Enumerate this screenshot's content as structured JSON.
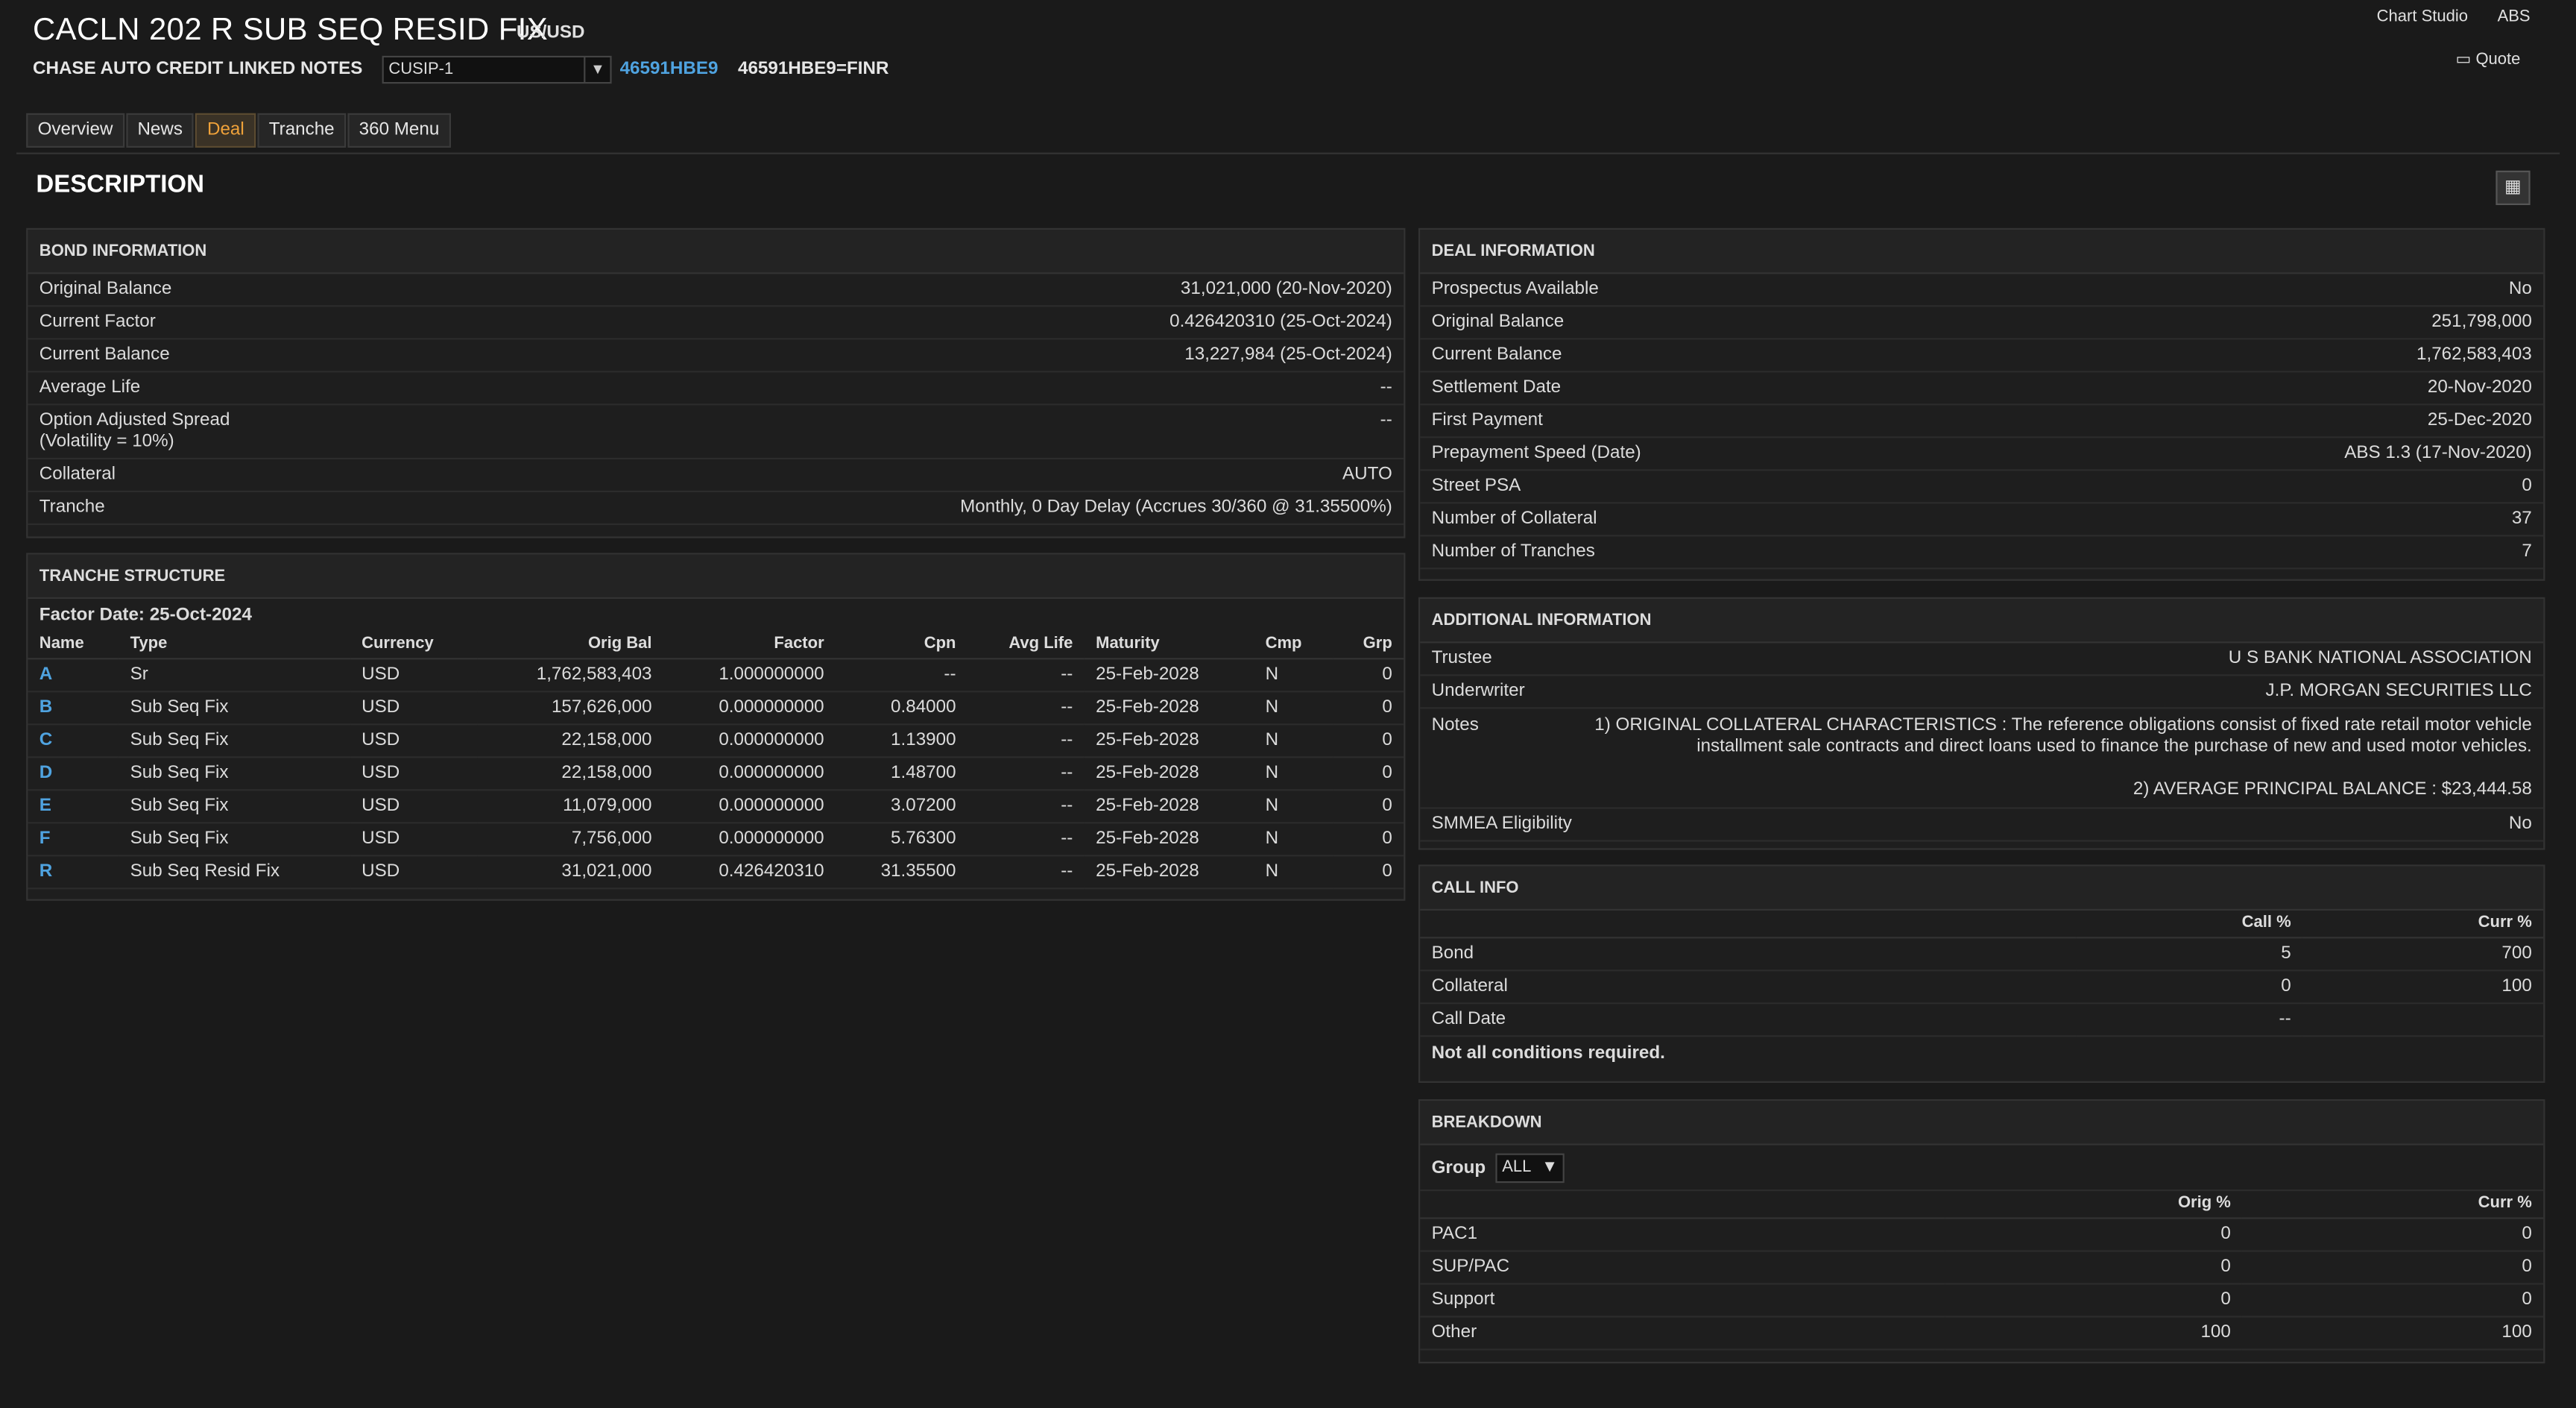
{
  "header": {
    "title": "CACLN 202 R SUB SEQ RESID FIX",
    "currency": "US/USD",
    "deal_name": "CHASE AUTO CREDIT LINKED NOTES",
    "id_type": "CUSIP-1",
    "cusip": "46591HBE9",
    "finr": "46591HBE9=FINR",
    "chart_studio": "Chart Studio",
    "abs": "ABS",
    "quote": "Quote"
  },
  "tabs": [
    "Overview",
    "News",
    "Deal",
    "Tranche",
    "360 Menu"
  ],
  "section_title": "DESCRIPTION",
  "bond": {
    "title": "BOND INFORMATION",
    "rows": [
      {
        "label": "Original Balance",
        "value": "31,021,000 (20-Nov-2020)"
      },
      {
        "label": "Current Factor",
        "value": "0.426420310 (25-Oct-2024)"
      },
      {
        "label": "Current Balance",
        "value": "13,227,984 (25-Oct-2024)"
      },
      {
        "label": "Average Life",
        "value": "--"
      },
      {
        "label": "Option Adjusted Spread",
        "label2": "(Volatility = 10%)",
        "value": "--"
      },
      {
        "label": "Collateral",
        "value": "AUTO"
      },
      {
        "label": "Tranche",
        "value": "Monthly, 0 Day Delay (Accrues 30/360 @ 31.35500%)"
      }
    ]
  },
  "tranche": {
    "title": "TRANCHE STRUCTURE",
    "factor_date": "Factor Date: 25-Oct-2024",
    "headers": [
      "Name",
      "Type",
      "Currency",
      "Orig Bal",
      "Factor",
      "Cpn",
      "Avg Life",
      "Maturity",
      "Cmp",
      "Grp"
    ],
    "rows": [
      [
        "A",
        "Sr",
        "USD",
        "1,762,583,403",
        "1.000000000",
        "--",
        "--",
        "25-Feb-2028",
        "N",
        "0"
      ],
      [
        "B",
        "Sub Seq Fix",
        "USD",
        "157,626,000",
        "0.000000000",
        "0.84000",
        "--",
        "25-Feb-2028",
        "N",
        "0"
      ],
      [
        "C",
        "Sub Seq Fix",
        "USD",
        "22,158,000",
        "0.000000000",
        "1.13900",
        "--",
        "25-Feb-2028",
        "N",
        "0"
      ],
      [
        "D",
        "Sub Seq Fix",
        "USD",
        "22,158,000",
        "0.000000000",
        "1.48700",
        "--",
        "25-Feb-2028",
        "N",
        "0"
      ],
      [
        "E",
        "Sub Seq Fix",
        "USD",
        "11,079,000",
        "0.000000000",
        "3.07200",
        "--",
        "25-Feb-2028",
        "N",
        "0"
      ],
      [
        "F",
        "Sub Seq Fix",
        "USD",
        "7,756,000",
        "0.000000000",
        "5.76300",
        "--",
        "25-Feb-2028",
        "N",
        "0"
      ],
      [
        "R",
        "Sub Seq Resid Fix",
        "USD",
        "31,021,000",
        "0.426420310",
        "31.35500",
        "--",
        "25-Feb-2028",
        "N",
        "0"
      ]
    ]
  },
  "deal": {
    "title": "DEAL INFORMATION",
    "rows": [
      {
        "label": "Prospectus Available",
        "value": "No"
      },
      {
        "label": "Original Balance",
        "value": "251,798,000"
      },
      {
        "label": "Current Balance",
        "value": "1,762,583,403"
      },
      {
        "label": "Settlement Date",
        "value": "20-Nov-2020"
      },
      {
        "label": "First Payment",
        "value": "25-Dec-2020"
      },
      {
        "label": "Prepayment Speed (Date)",
        "value": "ABS 1.3 (17-Nov-2020)"
      },
      {
        "label": "Street PSA",
        "value": "0"
      },
      {
        "label": "Number of Collateral",
        "value": "37"
      },
      {
        "label": "Number of Tranches",
        "value": "7"
      }
    ]
  },
  "additional": {
    "title": "ADDITIONAL INFORMATION",
    "trustee_label": "Trustee",
    "trustee": "U S BANK NATIONAL ASSOCIATION",
    "underwriter_label": "Underwriter",
    "underwriter": "J.P. MORGAN SECURITIES LLC",
    "notes_label": "Notes",
    "note1": "1) ORIGINAL COLLATERAL CHARACTERISTICS : The reference obligations consist of fixed rate retail motor vehicle installment sale contracts and direct loans used to finance the purchase of new and used motor vehicles.",
    "note2": "2) AVERAGE PRINCIPAL BALANCE : $23,444.58",
    "smmea_label": "SMMEA Eligibility",
    "smmea": "No"
  },
  "call": {
    "title": "CALL INFO",
    "h1": "Call %",
    "h2": "Curr %",
    "rows": [
      [
        "Bond",
        "5",
        "700"
      ],
      [
        "Collateral",
        "0",
        "100"
      ],
      [
        "Call Date",
        "--",
        ""
      ]
    ],
    "footer": "Not all conditions required."
  },
  "breakdown": {
    "title": "BREAKDOWN",
    "group_label": "Group",
    "group_value": "ALL",
    "h1": "Orig %",
    "h2": "Curr %",
    "rows": [
      [
        "PAC1",
        "0",
        "0"
      ],
      [
        "SUP/PAC",
        "0",
        "0"
      ],
      [
        "Support",
        "0",
        "0"
      ],
      [
        "Other",
        "100",
        "100"
      ]
    ]
  }
}
